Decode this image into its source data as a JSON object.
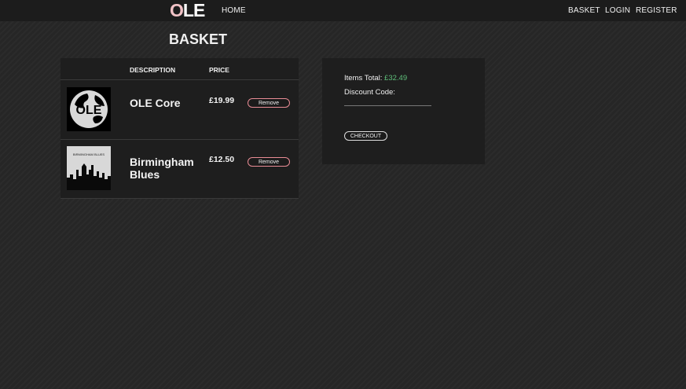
{
  "nav": {
    "logo_o": "O",
    "logo_le": "LE",
    "home": "HOME",
    "basket": "BASKET",
    "login": "LOGIN",
    "register": "REGISTER"
  },
  "page": {
    "title": "BASKET"
  },
  "table": {
    "headers": {
      "description": "DESCRIPTION",
      "price": "PRICE"
    },
    "items": [
      {
        "title": "OLE Core",
        "price": "£19.99",
        "remove": "Remove",
        "thumb": "ole-core-cover"
      },
      {
        "title": "Birmingham Blues",
        "price": "£12.50",
        "remove": "Remove",
        "thumb": "birmingham-blues-cover",
        "thumb_text": "BIRMINGHAM BLUES"
      }
    ]
  },
  "summary": {
    "items_total_label": "Items Total:",
    "items_total_value": "£32.49",
    "discount_label": "Discount Code:",
    "discount_value": "",
    "checkout": "CHECKOUT"
  },
  "colors": {
    "accent_pink": "#e98c95",
    "total_green": "#5fbf7a",
    "logo_pink": "#f1c2c6"
  }
}
